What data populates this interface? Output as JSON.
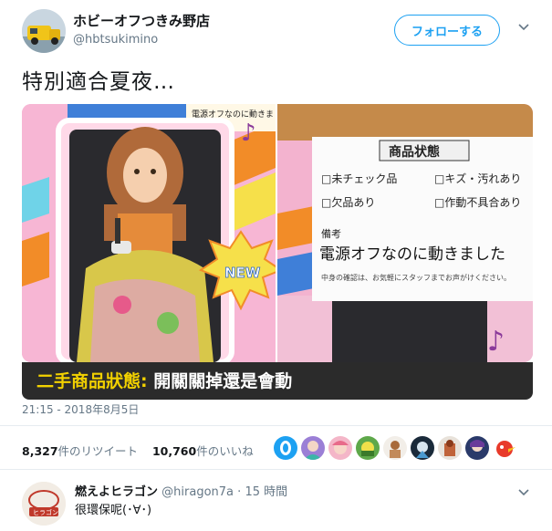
{
  "author": {
    "name": "ホビーオフつきみ野店",
    "handle": "@hbtsukimino"
  },
  "follow_label": "フォローする",
  "tweet_text": "特別適合夏夜…",
  "photo_left": {
    "box_top_text": "電源オフなのに動きました",
    "badge": "NEW"
  },
  "photo_right": {
    "card_title": "商品状態",
    "options": [
      "□未チェック品",
      "□キズ・汚れあり",
      "□欠品あり",
      "□作動不具合あり"
    ],
    "remark_label": "備考",
    "remark": "電源オフなのに動きました",
    "note": "中身の確認は、お気軽にスタッフまでお声がけください。"
  },
  "caption": {
    "label": "二手商品狀態:",
    "text": "開關關掉還是會動"
  },
  "timestamp": "21:15 - 2018年8月5日",
  "stats": {
    "retweets_count": "8,327",
    "retweets_label": "件のリツイート",
    "likes_count": "10,760",
    "likes_label": "件のいいね"
  },
  "likers": [
    "avatar-1",
    "avatar-2",
    "avatar-3",
    "avatar-4",
    "avatar-5",
    "avatar-6",
    "avatar-7",
    "avatar-8",
    "avatar-9"
  ],
  "reply": {
    "name": "燃えよヒラゴン",
    "handle": "@hiragon7a",
    "time": "15 時間",
    "text": "很環保呢(･∀･)"
  },
  "colors": {
    "accent": "#1da1f2",
    "caption_highlight": "#f2d100",
    "secondary_text": "#657786"
  }
}
